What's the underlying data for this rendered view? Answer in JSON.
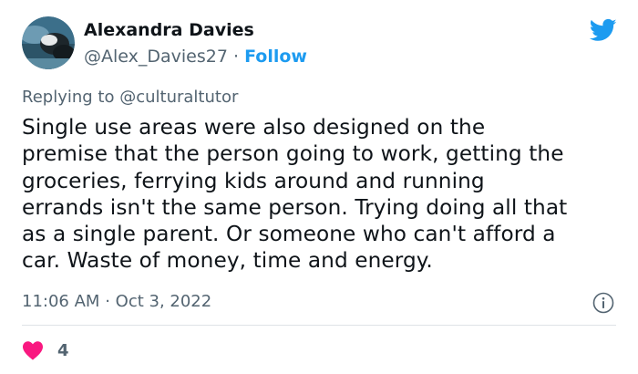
{
  "tweet": {
    "author": {
      "name": "Alexandra Davies",
      "handle": "@Alex_Davies27",
      "separator": "·",
      "follow_label": "Follow"
    },
    "reply": {
      "prefix": "Replying to",
      "mention": "@culturaltutor"
    },
    "text": "Single use areas were also designed on the\npremise that the person going to work, getting the\ngroceries, ferrying kids around and running\nerrands isn't the same person. Trying doing all that\nas a single parent. Or someone who can't afford a\ncar. Waste of money, time and energy.",
    "time": "11:06 AM",
    "date_separator": "·",
    "date": "Oct 3, 2022",
    "likes": "4"
  },
  "icons": {
    "brand": "twitter-bird-icon",
    "info": "info-icon",
    "like": "heart-icon"
  },
  "colors": {
    "brand_blue": "#1d9bf0",
    "text_primary": "#0f1419",
    "text_secondary": "#536471",
    "like_red": "#f91880",
    "divider": "#dfe3e7"
  }
}
